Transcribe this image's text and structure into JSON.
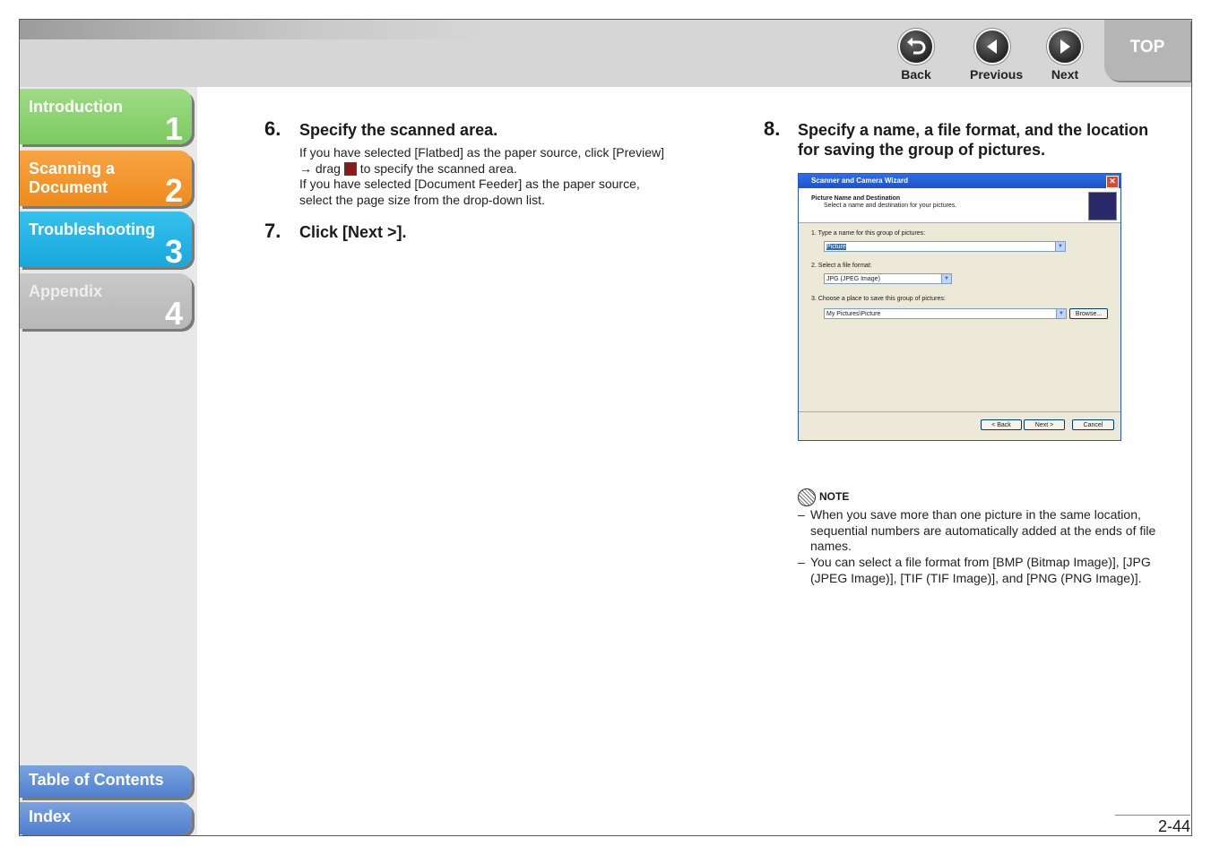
{
  "nav": {
    "back_label": "Back",
    "previous_label": "Previous",
    "next_label": "Next",
    "top_label": "TOP"
  },
  "sidebar": {
    "tabs": [
      {
        "label": "Introduction",
        "number": "1"
      },
      {
        "label": "Scanning a Document",
        "number": "2"
      },
      {
        "label": "Troubleshooting",
        "number": "3"
      },
      {
        "label": "Appendix",
        "number": "4"
      }
    ],
    "toc_label": "Table of Contents",
    "index_label": "Index"
  },
  "steps": {
    "s6": {
      "num": "6.",
      "heading": "Specify the scanned area.",
      "p1a": "If you have selected [Flatbed] as the paper source, click [Preview]",
      "p1b_pre": "→ drag",
      "p1b_post": "to specify the scanned area.",
      "p2a": "If you have selected [Document Feeder] as the paper source,",
      "p2b": "select the page size from the drop-down list."
    },
    "s7": {
      "num": "7.",
      "heading": "Click [Next >]."
    },
    "s8": {
      "num": "8.",
      "heading1": "Specify a name, a file format, and the location",
      "heading2": "for saving the group of pictures."
    }
  },
  "dialog": {
    "title": "Scanner and Camera Wizard",
    "header_title": "Picture Name and Destination",
    "header_sub": "Select a name and destination for your pictures.",
    "q1": "1.   Type a name for this group of pictures:",
    "name_value": "Picture",
    "q2": "2.   Select a file format:",
    "format_value": "JPG (JPEG Image)",
    "q3": "3.   Choose a place to save this group of pictures:",
    "place_value": "My Pictures\\Picture",
    "browse_label": "Browse...",
    "back_label": "< Back",
    "next_label": "Next >",
    "cancel_label": "Cancel"
  },
  "note": {
    "label": "NOTE",
    "items": [
      "When you save more than one picture in the same location, sequential numbers are automatically added at the ends of file names.",
      "You can select a file format from [BMP (Bitmap Image)], [JPG (JPEG Image)], [TIF (TIF Image)], and [PNG (PNG Image)]."
    ]
  },
  "page_number": "2-44"
}
